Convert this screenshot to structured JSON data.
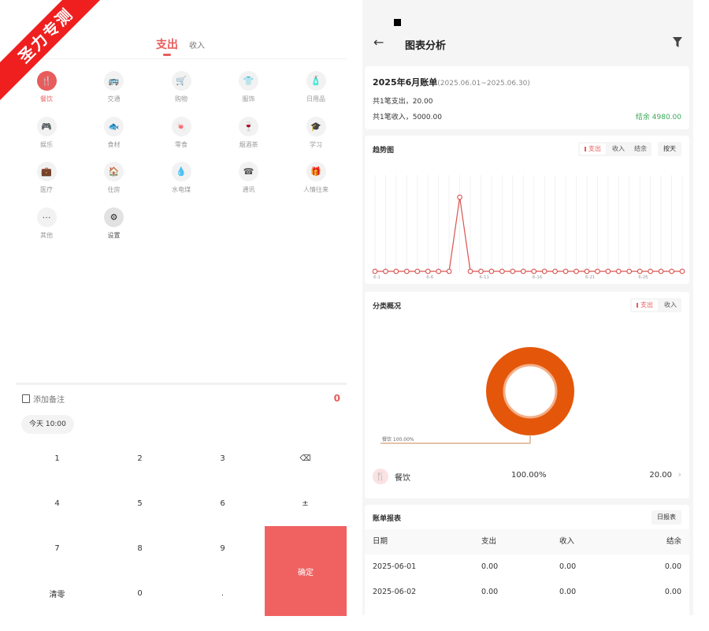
{
  "watermark": "圣力专测",
  "left": {
    "tabs": {
      "expense": "支出",
      "income": "收入"
    },
    "categories": [
      {
        "label": "餐饮",
        "icon": "fork-knife-icon",
        "glyph": "🍴"
      },
      {
        "label": "交通",
        "icon": "bus-icon",
        "glyph": "🚌"
      },
      {
        "label": "购物",
        "icon": "cart-icon",
        "glyph": "🛒"
      },
      {
        "label": "服饰",
        "icon": "shirt-icon",
        "glyph": "👕"
      },
      {
        "label": "日用品",
        "icon": "daily-goods-icon",
        "glyph": "🧴"
      },
      {
        "label": "娱乐",
        "icon": "gamepad-icon",
        "glyph": "🎮"
      },
      {
        "label": "食材",
        "icon": "fish-icon",
        "glyph": "🐟"
      },
      {
        "label": "零食",
        "icon": "snack-icon",
        "glyph": "🍬"
      },
      {
        "label": "烟酒茶",
        "icon": "wine-glass-icon",
        "glyph": "🍷"
      },
      {
        "label": "学习",
        "icon": "graduation-cap-icon",
        "glyph": "🎓"
      },
      {
        "label": "医疗",
        "icon": "medical-kit-icon",
        "glyph": "💼"
      },
      {
        "label": "住房",
        "icon": "house-icon",
        "glyph": "🏠"
      },
      {
        "label": "水电煤",
        "icon": "water-drop-icon",
        "glyph": "💧"
      },
      {
        "label": "通讯",
        "icon": "telephone-icon",
        "glyph": "☎"
      },
      {
        "label": "人情往来",
        "icon": "gift-icon",
        "glyph": "🎁"
      },
      {
        "label": "其他",
        "icon": "more-dots-icon",
        "glyph": "⋯"
      },
      {
        "label": "设置",
        "icon": "gear-icon",
        "glyph": "⚙"
      }
    ],
    "note_placeholder": "添加备注",
    "amount": "0",
    "date_chip": "今天 10:00",
    "keys": [
      "1",
      "2",
      "3",
      "⌫",
      "4",
      "5",
      "6",
      "±",
      "7",
      "8",
      "9",
      "确定",
      "清零",
      "0",
      "."
    ]
  },
  "right": {
    "title": "图表分析",
    "summary": {
      "title": "2025年6月账单",
      "range": "(2025.06.01~2025.06.30)",
      "expense_line": "共1笔支出，20.00",
      "income_line": "共1笔收入，5000.00",
      "balance": "结余 4980.00"
    },
    "trend": {
      "title": "趋势图",
      "seg": [
        "支出",
        "收入",
        "结余"
      ],
      "by": "按天"
    },
    "pie": {
      "title": "分类概况",
      "seg": [
        "支出",
        "收入"
      ],
      "label": "餐饮 100.00%",
      "legend": {
        "name": "餐饮",
        "pct": "100.00%",
        "value": "20.00"
      },
      "color": "#e4570a"
    },
    "table": {
      "title": "账单报表",
      "button": "日报表",
      "headers": [
        "日期",
        "支出",
        "收入",
        "结余"
      ],
      "rows": [
        [
          "2025-06-01",
          "0.00",
          "0.00",
          "0.00"
        ],
        [
          "2025-06-02",
          "0.00",
          "0.00",
          "0.00"
        ]
      ]
    }
  },
  "chart_data": {
    "type": "line",
    "x": [
      "6-1",
      "6-2",
      "6-3",
      "6-4",
      "6-5",
      "6-6",
      "6-7",
      "6-8",
      "6-9",
      "6-10",
      "6-11",
      "6-12",
      "6-13",
      "6-14",
      "6-15",
      "6-16",
      "6-17",
      "6-18",
      "6-19",
      "6-20",
      "6-21",
      "6-22",
      "6-23",
      "6-24",
      "6-25",
      "6-26",
      "6-27",
      "6-28",
      "6-29",
      "6-30"
    ],
    "x_tick_labels": [
      "6-1",
      "6-6",
      "6-11",
      "6-16",
      "6-21",
      "6-26"
    ],
    "series": [
      {
        "values": [
          0,
          0,
          0,
          0,
          0,
          0,
          0,
          0,
          20,
          0,
          0,
          0,
          0,
          0,
          0,
          0,
          0,
          0,
          0,
          0,
          0,
          0,
          0,
          0,
          0,
          0,
          0,
          0,
          0,
          0
        ]
      }
    ],
    "grid": true,
    "color": "#d9534f"
  }
}
